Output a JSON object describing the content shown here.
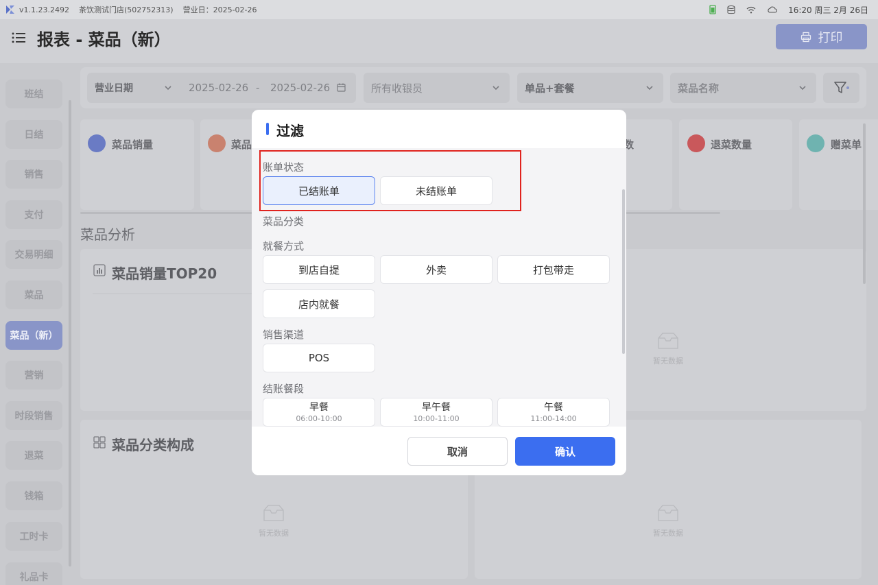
{
  "status_bar": {
    "version": "v1.1.23.2492",
    "store": "茶饮测试门店(502752313)",
    "business_day": "营业日：2025-02-26",
    "time": "16:20 周三 2月 26日"
  },
  "header": {
    "title": "报表 - 菜品（新）",
    "print_label": "打印"
  },
  "sidebar": {
    "items": [
      {
        "label": "班结"
      },
      {
        "label": "日结"
      },
      {
        "label": "销售"
      },
      {
        "label": "支付"
      },
      {
        "label": "交易明细"
      },
      {
        "label": "菜品"
      },
      {
        "label": "菜品（新）",
        "active": true
      },
      {
        "label": "营销"
      },
      {
        "label": "时段销售"
      },
      {
        "label": "退菜"
      },
      {
        "label": "钱箱"
      },
      {
        "label": "工时卡"
      },
      {
        "label": "礼品卡"
      }
    ]
  },
  "filters": {
    "date_type": "营业日期",
    "date_start": "2025-02-26",
    "date_sep": "-",
    "date_end": "2025-02-26",
    "cashier": "所有收银员",
    "item_type": "单品+套餐",
    "item_name": "菜品名称"
  },
  "metrics": [
    {
      "label": "菜品销量",
      "color": "#6a7bc4"
    },
    {
      "label": "菜品",
      "color": "#c9826f"
    },
    {
      "label": "数",
      "color": ""
    },
    {
      "label": "退菜数量",
      "color": "#c9585b"
    },
    {
      "label": "赠菜单",
      "color": "#6fb3b0"
    }
  ],
  "main": {
    "analysis_title": "菜品分析",
    "top20_title": "菜品销量TOP20",
    "category_title": "菜品分类构成",
    "empty_text": "暂无数据"
  },
  "modal": {
    "title": "过滤",
    "groups": {
      "bill_status": {
        "label": "账单状态",
        "options": [
          "已结账单",
          "未结账单"
        ],
        "selected": "已结账单"
      },
      "dish_category": {
        "label": "菜品分类"
      },
      "dining_mode": {
        "label": "就餐方式",
        "options": [
          "到店自提",
          "外卖",
          "打包带走",
          "店内就餐"
        ]
      },
      "sales_channel": {
        "label": "销售渠道",
        "options": [
          "POS"
        ]
      },
      "meal_period": {
        "label": "结账餐段",
        "options": [
          {
            "name": "早餐",
            "time": "06:00-10:00"
          },
          {
            "name": "早午餐",
            "time": "10:00-11:00"
          },
          {
            "name": "午餐",
            "time": "11:00-14:00"
          }
        ]
      }
    },
    "cancel_label": "取消",
    "confirm_label": "确认"
  },
  "colors": {
    "accent": "#3b6ef0",
    "highlight": "#e0231e"
  }
}
